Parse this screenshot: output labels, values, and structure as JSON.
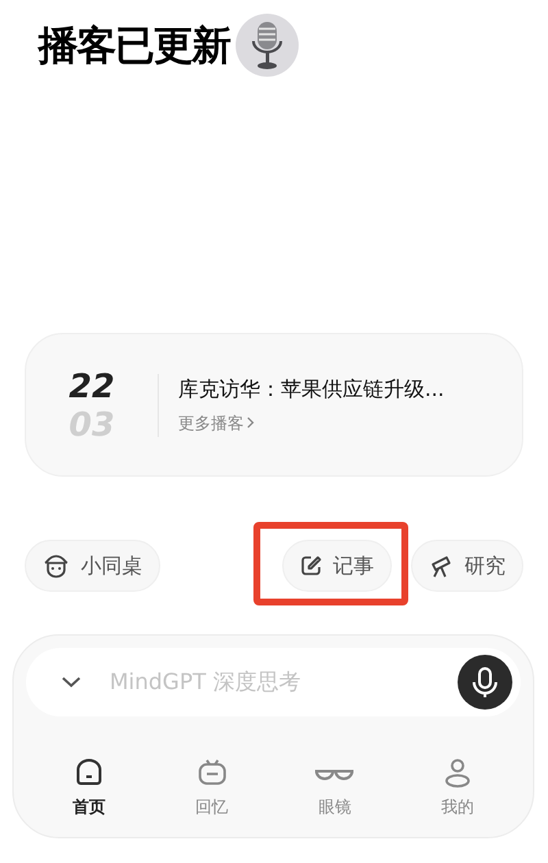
{
  "header": {
    "title": "播客已更新"
  },
  "podcast_card": {
    "day": "22",
    "month": "03",
    "title": "库克访华：苹果供应链升级...",
    "link": "更多播客"
  },
  "chips": [
    {
      "kind": "buddy",
      "label": "小同桌",
      "highlighted": false
    },
    {
      "kind": "note",
      "label": "记事",
      "highlighted": true
    },
    {
      "kind": "research",
      "label": "研究",
      "highlighted": false
    }
  ],
  "input": {
    "placeholder": "MindGPT 深度思考"
  },
  "nav": [
    {
      "kind": "home",
      "label": "首页",
      "selected": true
    },
    {
      "kind": "memory",
      "label": "回忆",
      "selected": false
    },
    {
      "kind": "glasses",
      "label": "眼镜",
      "selected": false
    },
    {
      "kind": "me",
      "label": "我的",
      "selected": false
    }
  ]
}
